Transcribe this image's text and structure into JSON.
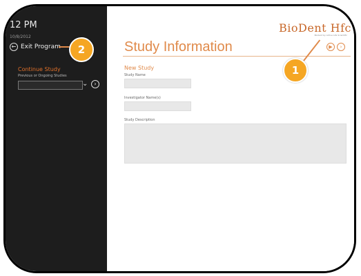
{
  "sidebar": {
    "time": "12 PM",
    "date": "10/8/2012",
    "exit_label": "Exit Program",
    "continue_heading": "Continue Study",
    "previous_label": "Previous or Ongoing Studies"
  },
  "header": {
    "logo": "BioDent Hfc",
    "logo_tagline": "Biodent by Active Life Scientific",
    "title": "Study Information"
  },
  "form": {
    "section": "New Study",
    "study_name_label": "Study Name",
    "investigators_label": "Investigator Name(s)",
    "description_label": "Study Description"
  },
  "callouts": {
    "badge1": "1",
    "badge2": "2"
  },
  "colors": {
    "accent": "#e08a4a",
    "badge": "#f5a623",
    "sidebar_bg": "#1d1d1d"
  }
}
